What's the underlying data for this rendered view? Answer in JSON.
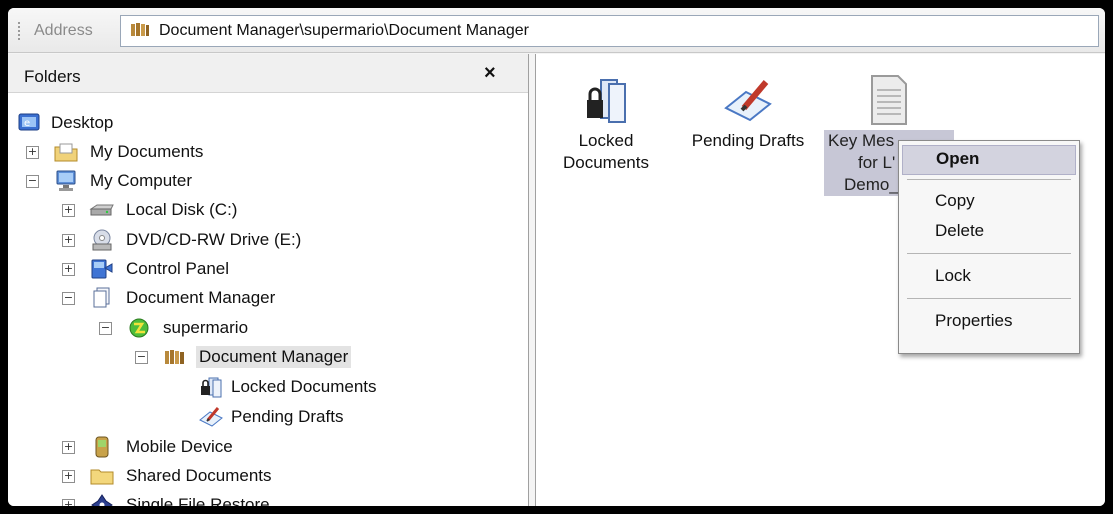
{
  "address": {
    "label": "Address",
    "path": "Document Manager\\supermario\\Document Manager"
  },
  "folders": {
    "title": "Folders",
    "close": "×",
    "items": [
      {
        "label": "Desktop",
        "icon": "desktop-icon"
      },
      {
        "label": "My Documents",
        "icon": "my-documents-icon",
        "expander": "+"
      },
      {
        "label": "My Computer",
        "icon": "my-computer-icon",
        "expander": "−"
      },
      {
        "label": "Local Disk (C:)",
        "icon": "local-disk-icon",
        "expander": "+"
      },
      {
        "label": "DVD/CD-RW Drive (E:)",
        "icon": "dvd-drive-icon",
        "expander": "+"
      },
      {
        "label": "Control Panel",
        "icon": "control-panel-icon",
        "expander": "+"
      },
      {
        "label": "Document Manager",
        "icon": "document-manager-icon",
        "expander": "−"
      },
      {
        "label": "supermario",
        "icon": "server-icon",
        "expander": "−"
      },
      {
        "label": "Document Manager",
        "icon": "library-icon",
        "expander": "−",
        "selected": true
      },
      {
        "label": "Locked Documents",
        "icon": "locked-documents-icon"
      },
      {
        "label": "Pending Drafts",
        "icon": "pending-drafts-icon"
      },
      {
        "label": "Mobile Device",
        "icon": "mobile-device-icon",
        "expander": "+"
      },
      {
        "label": "Shared Documents",
        "icon": "folder-icon",
        "expander": "+"
      },
      {
        "label": "Single File Restore",
        "icon": "restore-icon",
        "expander": "+"
      }
    ]
  },
  "content": {
    "items": [
      {
        "line1": "Locked",
        "line2": "Documents",
        "icon": "locked-documents-icon"
      },
      {
        "line1": "Pending Drafts",
        "line2": "",
        "icon": "pending-drafts-icon"
      },
      {
        "line1": "Key Mes",
        "line2": "for L'",
        "line3": "Demo_",
        "icon": "document-icon",
        "selected": true
      }
    ]
  },
  "context_menu": {
    "items": [
      "Open",
      "Copy",
      "Delete",
      "Lock",
      "Properties"
    ],
    "highlighted": "Open"
  },
  "colors": {
    "selection": "#c7c7d6",
    "menu_highlight": "#d3d3df",
    "accent_blue": "#2b63c9"
  }
}
